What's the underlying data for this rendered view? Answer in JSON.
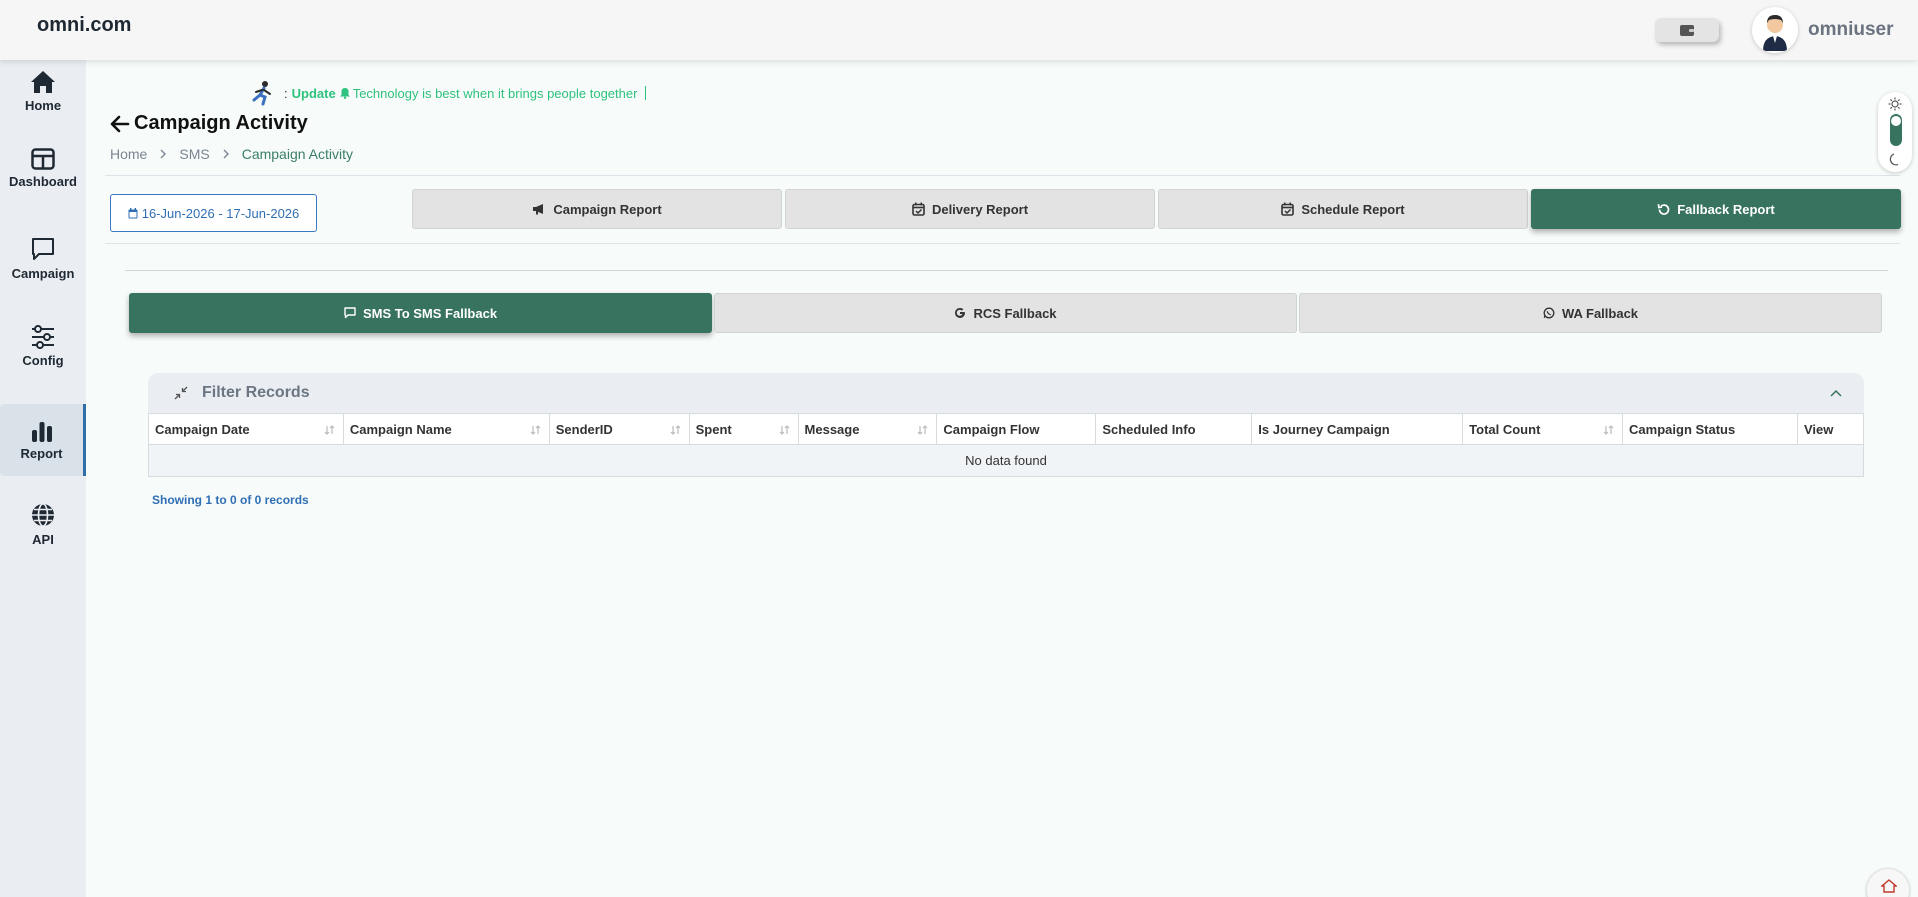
{
  "header": {
    "brand": "omni.com",
    "username": "omniuser"
  },
  "sidebar": {
    "items": [
      {
        "label": "Home",
        "icon": "home-icon"
      },
      {
        "label": "Dashboard",
        "icon": "dashboard-icon"
      },
      {
        "label": "Campaign",
        "icon": "chat-icon"
      },
      {
        "label": "Config",
        "icon": "sliders-icon"
      },
      {
        "label": "Report",
        "icon": "bar-chart-icon",
        "active": true
      },
      {
        "label": "API",
        "icon": "globe-icon"
      }
    ]
  },
  "ticker": {
    "prefix": ":",
    "label": "Update",
    "message": "Technology is best when it brings people together"
  },
  "page": {
    "title": "Campaign Activity",
    "breadcrumb": [
      "Home",
      "SMS",
      "Campaign Activity"
    ]
  },
  "date_range": "16-Jun-2026 - 17-Jun-2026",
  "report_tabs": [
    {
      "label": "Campaign Report",
      "icon": "megaphone-icon"
    },
    {
      "label": "Delivery Report",
      "icon": "calendar-check-icon"
    },
    {
      "label": "Schedule Report",
      "icon": "calendar-check-icon"
    },
    {
      "label": "Fallback Report",
      "icon": "rotate-icon",
      "active": true
    }
  ],
  "fallback_tabs": [
    {
      "label": "SMS To SMS Fallback",
      "icon": "chat-icon",
      "active": true
    },
    {
      "label": "RCS Fallback",
      "icon": "google-icon"
    },
    {
      "label": "WA Fallback",
      "icon": "whatsapp-icon"
    }
  ],
  "filter": {
    "title": "Filter Records"
  },
  "table": {
    "columns": [
      "Campaign Date",
      "Campaign Name",
      "SenderID",
      "Spent",
      "Message",
      "Campaign Flow",
      "Scheduled Info",
      "Is Journey Campaign",
      "Total Count",
      "Campaign Status",
      "View"
    ],
    "sortable": [
      true,
      true,
      true,
      true,
      true,
      false,
      false,
      false,
      true,
      false,
      false
    ],
    "empty_message": "No data found",
    "showing": "Showing 1 to 0 of 0 records"
  },
  "colors": {
    "accent": "#37735e",
    "link": "#2f6fb5",
    "ticker": "#2ec27e"
  }
}
